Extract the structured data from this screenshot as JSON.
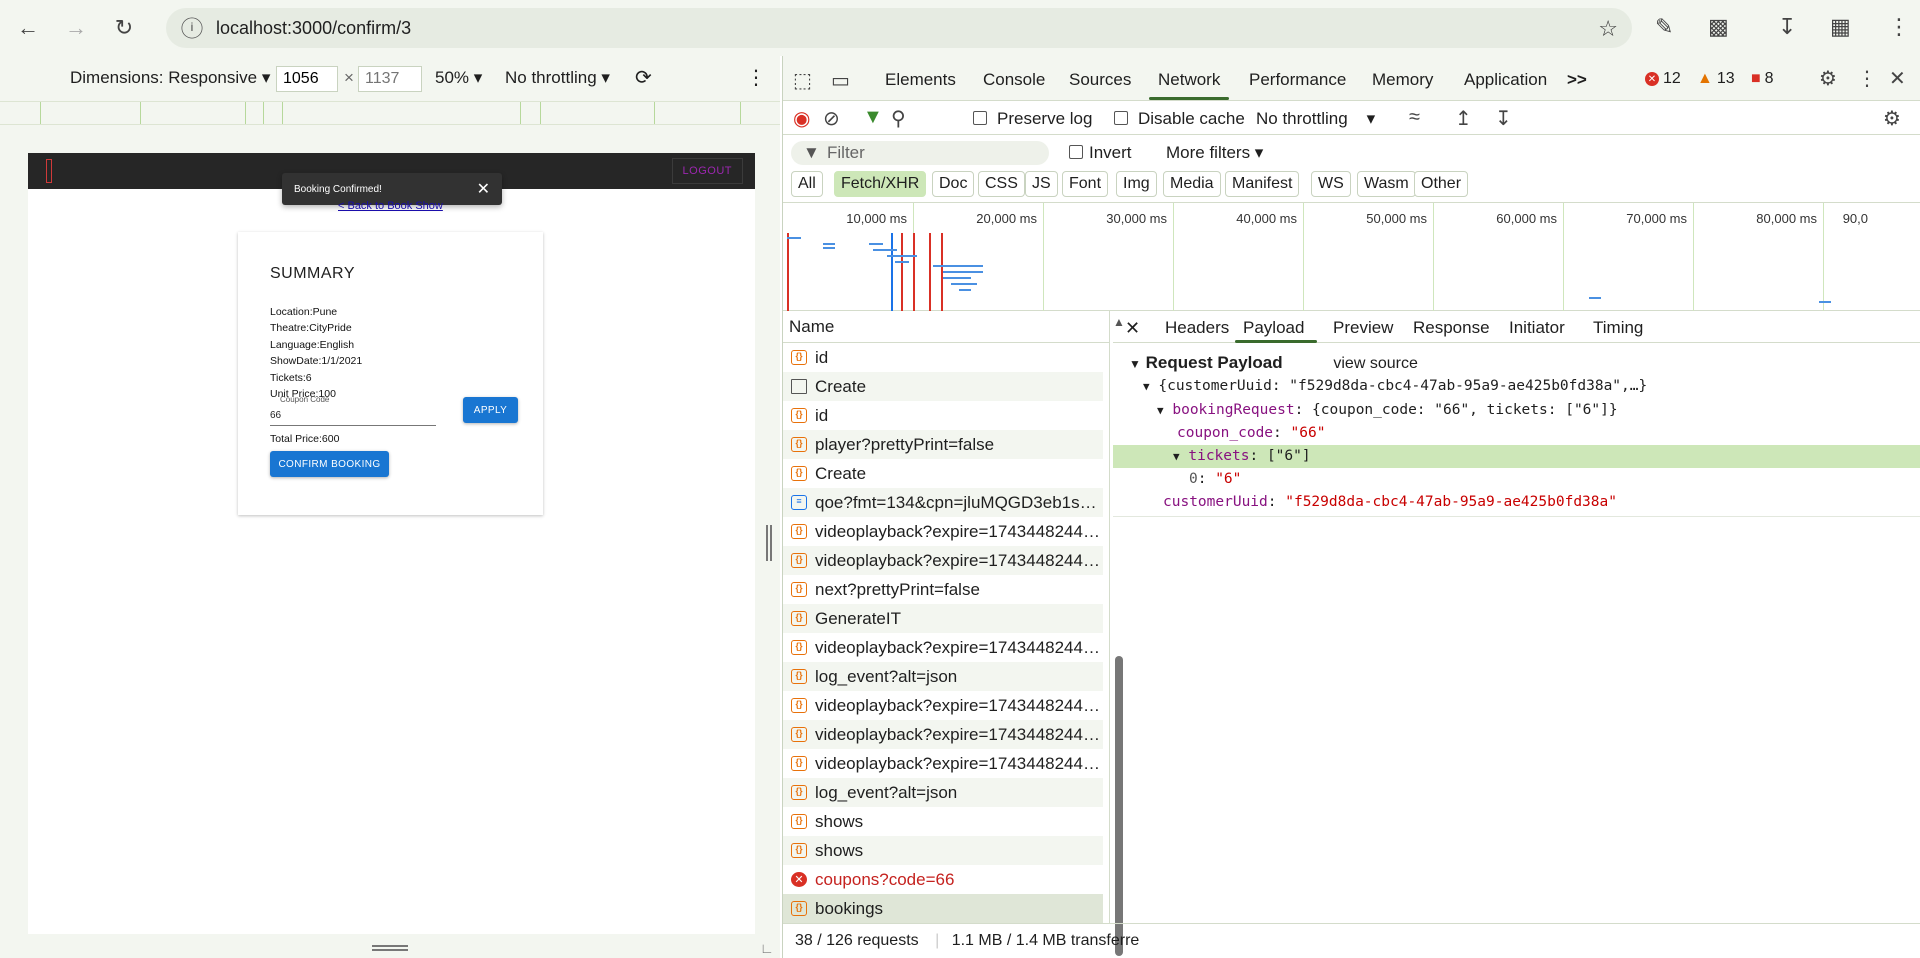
{
  "browser": {
    "url": "localhost:3000/confirm/3"
  },
  "device_toolbar": {
    "dimensions_label": "Dimensions: Responsive",
    "width": "1056",
    "height_placeholder": "1137",
    "zoom": "50%",
    "throttling": "No throttling"
  },
  "app": {
    "logout_label": "LOGOUT",
    "toast_message": "Booking Confirmed!",
    "back_link": "< Back to Book Show",
    "summary_title": "SUMMARY",
    "lines": [
      "Location:Pune",
      "Theatre:CityPride",
      "Language:English",
      "ShowDate:1/1/2021",
      "Tickets:6",
      "Unit Price:100"
    ],
    "coupon_label": "Coupon Code",
    "coupon_value": "66",
    "apply_label": "APPLY",
    "total_price": "Total Price:600",
    "confirm_label": "CONFIRM BOOKING"
  },
  "devtools": {
    "tabs": [
      "Elements",
      "Console",
      "Sources",
      "Network",
      "Performance",
      "Memory",
      "Application"
    ],
    "active_tab": "Network",
    "more_tabs": ">>",
    "errors": "12",
    "warnings": "13",
    "issues": "8",
    "preserve_log": "Preserve log",
    "disable_cache": "Disable cache",
    "throttling": "No throttling",
    "filter_placeholder": "Filter",
    "invert": "Invert",
    "more_filters": "More filters",
    "type_filters": [
      "All",
      "Fetch/XHR",
      "Doc",
      "CSS",
      "JS",
      "Font",
      "Img",
      "Media",
      "Manifest",
      "WS",
      "Wasm",
      "Other"
    ],
    "active_filter": "Fetch/XHR",
    "timeline_labels": [
      "10,000 ms",
      "20,000 ms",
      "30,000 ms",
      "40,000 ms",
      "50,000 ms",
      "60,000 ms",
      "70,000 ms",
      "80,000 ms",
      "90,0"
    ],
    "list_header": "Name",
    "requests": [
      {
        "name": "id",
        "type": "xhr"
      },
      {
        "name": "Create",
        "type": "doc"
      },
      {
        "name": "id",
        "type": "xhr"
      },
      {
        "name": "player?prettyPrint=false",
        "type": "xhr"
      },
      {
        "name": "Create",
        "type": "xhr"
      },
      {
        "name": "qoe?fmt=134&cpn=jluMQGD3eb1she...",
        "type": "blue"
      },
      {
        "name": "videoplayback?expire=1743448244&e...",
        "type": "xhr"
      },
      {
        "name": "videoplayback?expire=1743448244&e...",
        "type": "xhr"
      },
      {
        "name": "next?prettyPrint=false",
        "type": "xhr"
      },
      {
        "name": "GenerateIT",
        "type": "xhr"
      },
      {
        "name": "videoplayback?expire=1743448244&e...",
        "type": "xhr"
      },
      {
        "name": "log_event?alt=json",
        "type": "xhr"
      },
      {
        "name": "videoplayback?expire=1743448244&e...",
        "type": "xhr"
      },
      {
        "name": "videoplayback?expire=1743448244&e...",
        "type": "xhr"
      },
      {
        "name": "videoplayback?expire=1743448244&e...",
        "type": "xhr"
      },
      {
        "name": "log_event?alt=json",
        "type": "xhr"
      },
      {
        "name": "shows",
        "type": "xhr"
      },
      {
        "name": "shows",
        "type": "xhr"
      },
      {
        "name": "coupons?code=66",
        "type": "err"
      },
      {
        "name": "bookings",
        "type": "xhr"
      }
    ],
    "detail_tabs": [
      "Headers",
      "Payload",
      "Preview",
      "Response",
      "Initiator",
      "Timing"
    ],
    "active_detail_tab": "Payload",
    "payload": {
      "section_title": "Request Payload",
      "view_source": "view source",
      "root": "{customerUuid: \"f529d8da-cbc4-47ab-95a9-ae425b0fd38a\",…}",
      "booking_key": "bookingRequest",
      "booking_summary": "{coupon_code: \"66\", tickets: [\"6\"]}",
      "coupon_key": "coupon_code",
      "coupon_val": "\"66\"",
      "tickets_key": "tickets",
      "tickets_summary": "[\"6\"]",
      "ticket0_key": "0",
      "ticket0_val": "\"6\"",
      "customer_key": "customerUuid",
      "customer_val": "\"f529d8da-cbc4-47ab-95a9-ae425b0fd38a\""
    },
    "status_requests": "38 / 126 requests",
    "status_transferred": "1.1 MB / 1.4 MB transferre"
  },
  "colors": {
    "accent": "#1976d2",
    "chrome_bg": "#f3f6f0",
    "error": "#d93025",
    "highlight": "#cde7b8"
  }
}
